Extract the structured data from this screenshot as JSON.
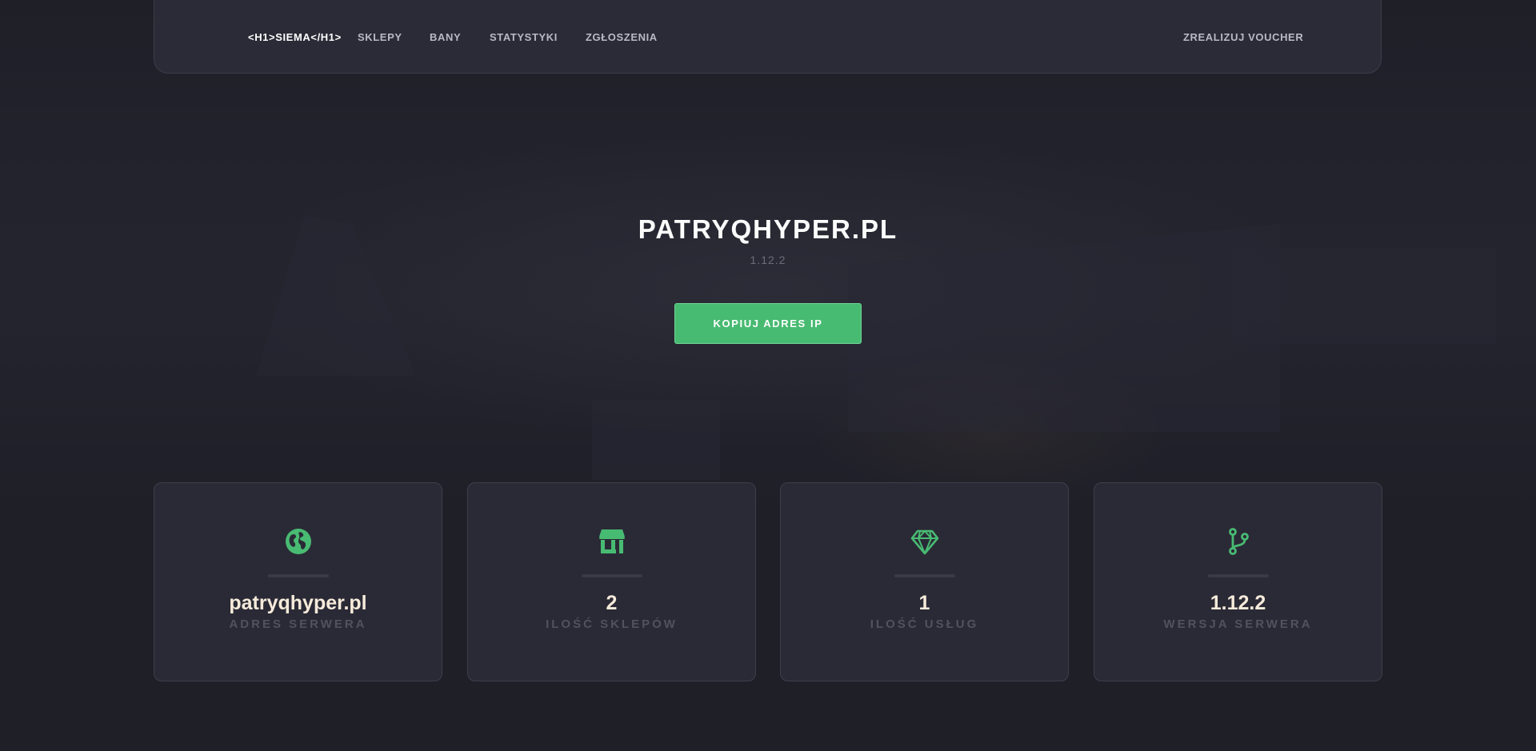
{
  "navbar": {
    "brand": "<H1>SIEMA</H1>",
    "items": [
      "SKLEPY",
      "BANY",
      "STATYSTYKI",
      "ZGŁOSZENIA"
    ],
    "voucher": "ZREALIZUJ VOUCHER"
  },
  "hero": {
    "title": "PATRYQHYPER.PL",
    "version": "1.12.2",
    "copy_button": "KOPIUJ ADRES IP"
  },
  "stats": [
    {
      "icon": "globe-icon",
      "value": "patryqhyper.pl",
      "label": "ADRES SERWERA"
    },
    {
      "icon": "store-icon",
      "value": "2",
      "label": "ILOŚĆ SKLEPÓW"
    },
    {
      "icon": "gem-icon",
      "value": "1",
      "label": "ILOŚĆ USŁUG"
    },
    {
      "icon": "code-branch-icon",
      "value": "1.12.2",
      "label": "WERSJA SERWERA"
    }
  ],
  "colors": {
    "accent": "#48bb72",
    "background": "#1f1f28",
    "card": "#2a2a36",
    "value_text": "#f6eada",
    "label_text": "#52525f"
  }
}
